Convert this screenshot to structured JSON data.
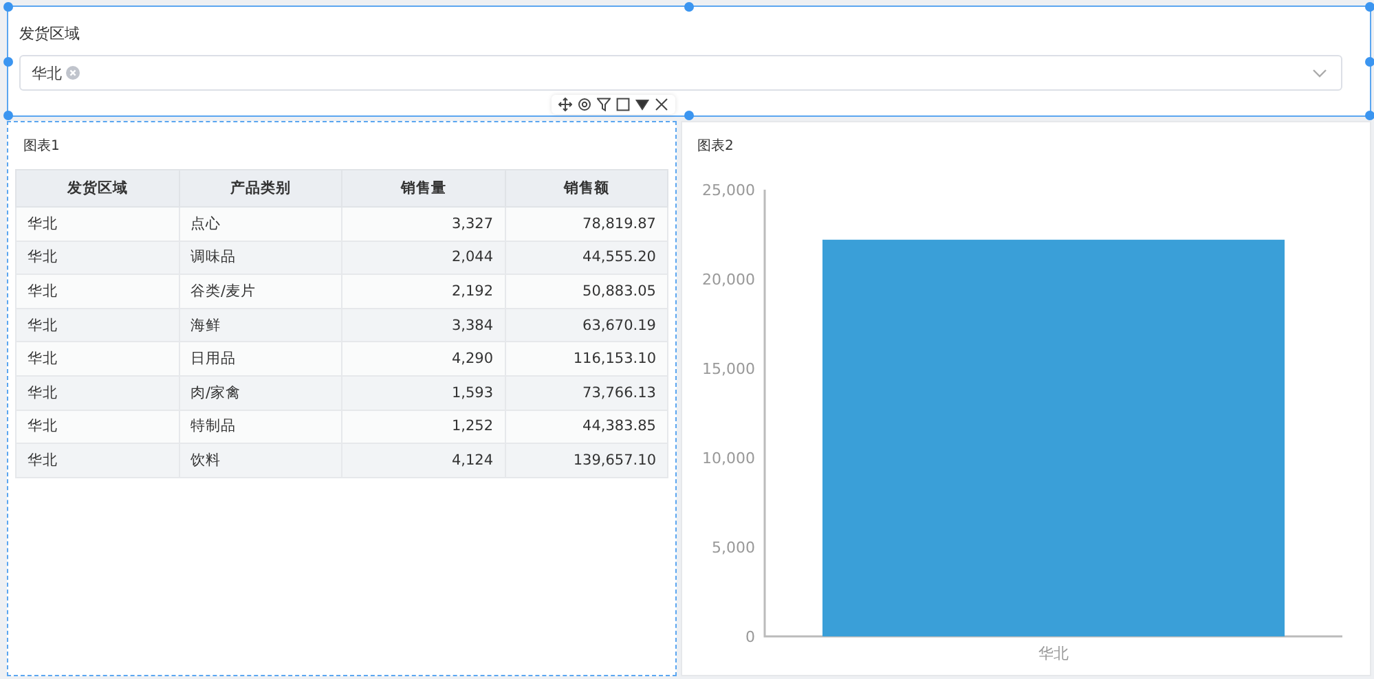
{
  "filter": {
    "label": "发货区域",
    "tags": [
      {
        "label": "华北"
      }
    ]
  },
  "table_panel": {
    "title": "图表1",
    "columns": [
      "发货区域",
      "产品类别",
      "销售量",
      "销售额"
    ],
    "rows": [
      [
        "华北",
        "点心",
        "3,327",
        "78,819.87"
      ],
      [
        "华北",
        "调味品",
        "2,044",
        "44,555.20"
      ],
      [
        "华北",
        "谷类/麦片",
        "2,192",
        "50,883.05"
      ],
      [
        "华北",
        "海鲜",
        "3,384",
        "63,670.19"
      ],
      [
        "华北",
        "日用品",
        "4,290",
        "116,153.10"
      ],
      [
        "华北",
        "肉/家禽",
        "1,593",
        "73,766.13"
      ],
      [
        "华北",
        "特制品",
        "1,252",
        "44,383.85"
      ],
      [
        "华北",
        "饮料",
        "4,124",
        "139,657.10"
      ]
    ]
  },
  "chart_panel": {
    "title": "图表2",
    "chart_data": {
      "type": "bar",
      "categories": [
        "华北"
      ],
      "series": [
        {
          "color": "#3a9fd8",
          "values": [
            22200
          ]
        }
      ],
      "ylim": [
        0,
        25000
      ],
      "yticks": [
        {
          "value": 0,
          "label": "0"
        },
        {
          "value": 5000,
          "label": "5,000"
        },
        {
          "value": 10000,
          "label": "10,000"
        },
        {
          "value": 15000,
          "label": "15,000"
        },
        {
          "value": 20000,
          "label": "20,000"
        },
        {
          "value": 25000,
          "label": "25,000"
        }
      ]
    }
  }
}
